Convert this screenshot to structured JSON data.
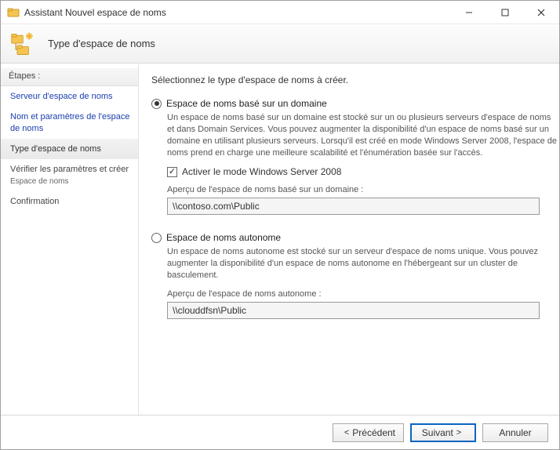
{
  "window": {
    "title": "Assistant Nouvel espace de noms"
  },
  "header": {
    "title": "Type d'espace de noms"
  },
  "sidebar": {
    "steps_label": "Étapes :",
    "step_server": "Serveur d'espace de noms",
    "step_name": "Nom et paramètres de l'espace de noms",
    "step_type": "Type d'espace de noms",
    "step_review": "Vérifier les paramètres et créer",
    "step_review_sub": "Espace de noms",
    "step_confirm": "Confirmation"
  },
  "main": {
    "instruction": "Sélectionnez le type d'espace de noms à créer.",
    "opt_domain": {
      "label": "Espace de noms basé sur un domaine",
      "desc": "Un espace de noms basé sur un domaine est stocké sur un ou plusieurs serveurs d'espace de noms et dans Domain Services. Vous pouvez augmenter la disponibilité d'un espace de noms basé sur un domaine en utilisant plusieurs serveurs. Lorsqu'il est créé en mode Windows Server 2008, l'espace de noms prend en charge une meilleure scalabilité et l'énumération basée sur l'accès.",
      "check_label": "Activer le mode Windows Server 2008",
      "preview_label": "Aperçu de l'espace de noms basé sur un domaine :",
      "preview_value": "\\\\contoso.com\\Public"
    },
    "opt_standalone": {
      "label": "Espace de noms autonome",
      "desc": "Un espace de noms autonome est stocké sur un serveur d'espace de noms unique. Vous pouvez augmenter la disponibilité d'un espace de noms autonome en l'hébergeant sur un cluster de basculement.",
      "preview_label": "Aperçu de l'espace de noms autonome :",
      "preview_value": "\\\\clouddfsn\\Public"
    }
  },
  "footer": {
    "prev": "Précédent",
    "next": "Suivant",
    "cancel": "Annuler"
  }
}
